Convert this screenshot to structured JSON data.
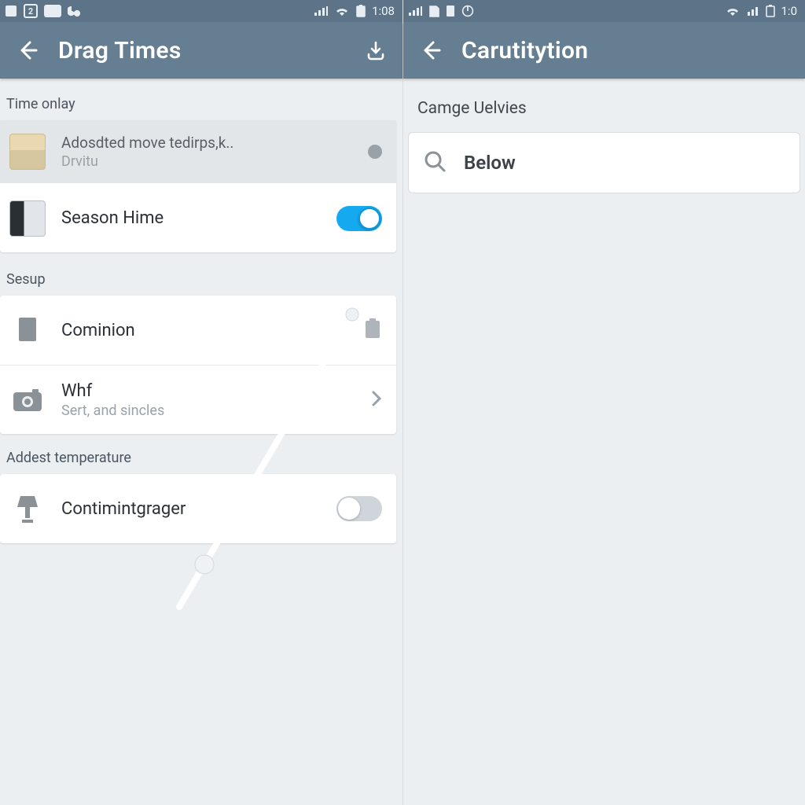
{
  "left": {
    "status": {
      "badge": "2",
      "time": "1:08"
    },
    "appbar": {
      "title": "Drag Times"
    },
    "sections": {
      "time": {
        "label": "Time onlay",
        "row0": {
          "title": "Adosdted move tedirps,k..",
          "subtitle": "Drvitu"
        },
        "row1": {
          "title": "Season Hime"
        }
      },
      "setup": {
        "label": "Sesup",
        "row0": {
          "title": "Cominion"
        },
        "row1": {
          "title": "Whf",
          "subtitle": "Sert, and sincles"
        }
      },
      "temp": {
        "label": "Addest temperature",
        "row0": {
          "title": "Contimintgrager"
        }
      }
    }
  },
  "right": {
    "status": {
      "time": "1:0"
    },
    "appbar": {
      "title": "Carutitytion"
    },
    "section_label": "Camge Uelvies",
    "search_hint": "Below"
  }
}
